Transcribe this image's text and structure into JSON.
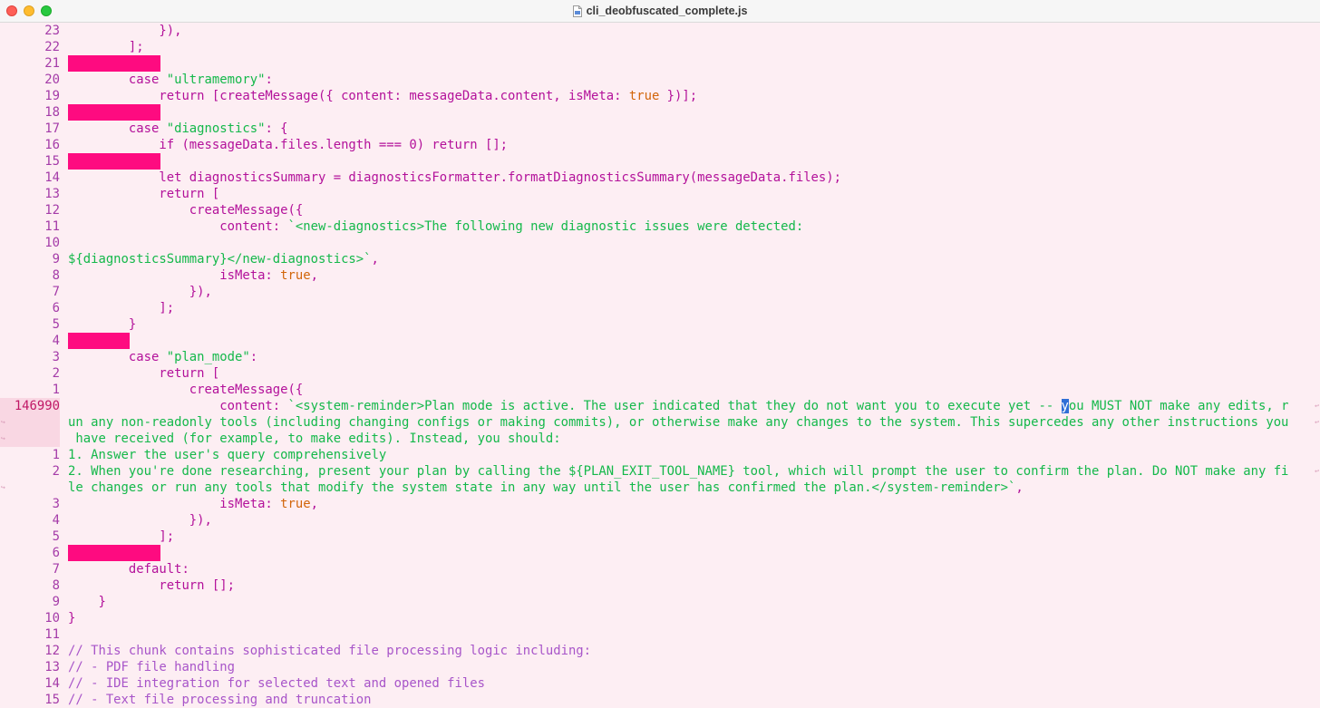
{
  "window": {
    "title": "cli_deobfuscated_complete.js"
  },
  "editor": {
    "lines": [
      {
        "num": "23",
        "code": "            }),"
      },
      {
        "num": "22",
        "code": "        ];"
      },
      {
        "num": "21",
        "code": "",
        "mark": 102
      },
      {
        "num": "20",
        "code": "        case \"ultramemory\":"
      },
      {
        "num": "19",
        "code": "            return [createMessage({ content: messageData.content, isMeta: true })];"
      },
      {
        "num": "18",
        "code": "",
        "mark": 102
      },
      {
        "num": "17",
        "code": "        case \"diagnostics\": {"
      },
      {
        "num": "16",
        "code": "            if (messageData.files.length === 0) return [];"
      },
      {
        "num": "15",
        "code": "",
        "mark": 102
      },
      {
        "num": "14",
        "code": "            let diagnosticsSummary = diagnosticsFormatter.formatDiagnosticsSummary(messageData.files);"
      },
      {
        "num": "13",
        "code": "            return ["
      },
      {
        "num": "12",
        "code": "                createMessage({"
      },
      {
        "num": "11",
        "code": "                    content: `<new-diagnostics>The following new diagnostic issues were detected:"
      },
      {
        "num": "10",
        "code": ""
      },
      {
        "num": "9",
        "code": "${diagnosticsSummary}</new-diagnostics>`,"
      },
      {
        "num": "8",
        "code": "                    isMeta: true,"
      },
      {
        "num": "7",
        "code": "                }),"
      },
      {
        "num": "6",
        "code": "            ];"
      },
      {
        "num": "5",
        "code": "        }"
      },
      {
        "num": "4",
        "code": "",
        "mark": 68
      },
      {
        "num": "3",
        "code": "        case \"plan_mode\":"
      },
      {
        "num": "2",
        "code": "            return ["
      },
      {
        "num": "1",
        "code": "                createMessage({"
      },
      {
        "num": "146990",
        "current": true,
        "code": "                    content: `<system-reminder>Plan mode is active. The user indicated that they do not want you to execute yet -- you MUST NOT make any edits, r"
      },
      {
        "num": "",
        "current": true,
        "code": "un any non-readonly tools (including changing configs or making commits), or otherwise make any changes to the system. This supercedes any other instructions you"
      },
      {
        "num": "",
        "current": true,
        "code": " have received (for example, to make edits). Instead, you should:"
      },
      {
        "num": "1",
        "code": "1. Answer the user's query comprehensively"
      },
      {
        "num": "2",
        "code": "2. When you're done researching, present your plan by calling the ${PLAN_EXIT_TOOL_NAME} tool, which will prompt the user to confirm the plan. Do NOT make any fi"
      },
      {
        "num": "",
        "code": "le changes or run any tools that modify the system state in any way until the user has confirmed the plan.</system-reminder>`,"
      },
      {
        "num": "3",
        "code": "                    isMeta: true,"
      },
      {
        "num": "4",
        "code": "                }),"
      },
      {
        "num": "5",
        "code": "            ];"
      },
      {
        "num": "6",
        "code": "",
        "mark": 102
      },
      {
        "num": "7",
        "code": "        default:"
      },
      {
        "num": "8",
        "code": "            return [];"
      },
      {
        "num": "9",
        "code": "    }"
      },
      {
        "num": "10",
        "code": "}"
      },
      {
        "num": "11",
        "code": ""
      },
      {
        "num": "12",
        "code": "// This chunk contains sophisticated file processing logic including:"
      },
      {
        "num": "13",
        "code": "// - PDF file handling"
      },
      {
        "num": "14",
        "code": "// - IDE integration for selected text and opened files"
      },
      {
        "num": "15",
        "code": "// - Text file processing and truncation"
      }
    ]
  },
  "colors": {
    "background": "#fdeef3",
    "keyword": "#b3119a",
    "string": "#14b84a",
    "comment": "#a855c9",
    "boolean": "#d2650a",
    "marker": "#fe0b80",
    "current_line": "#f9d7e3"
  }
}
